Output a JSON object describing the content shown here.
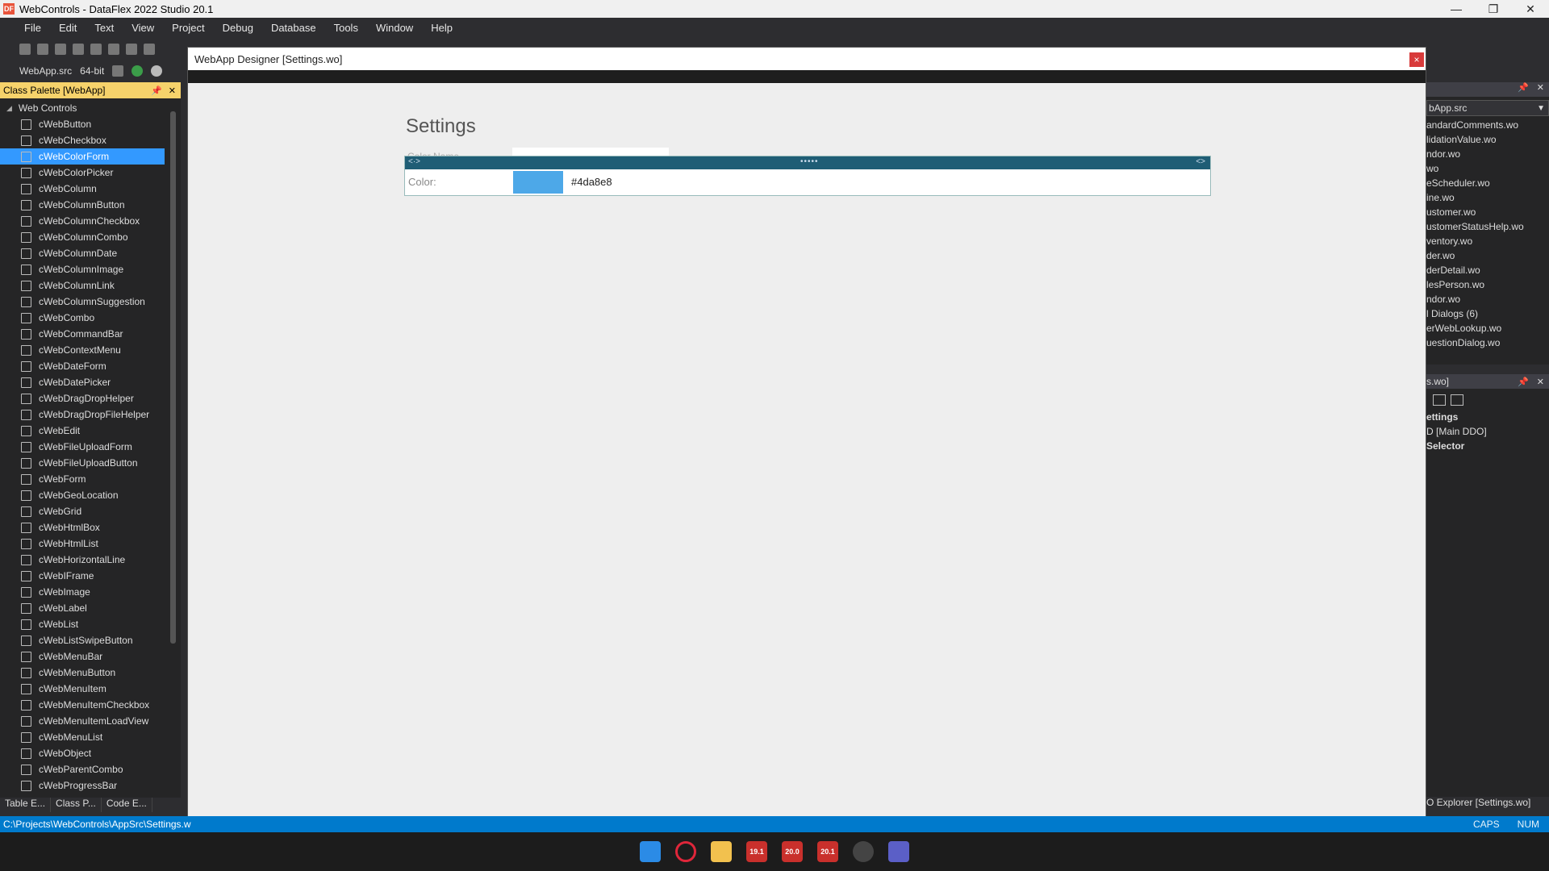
{
  "window": {
    "title": "WebControls - DataFlex 2022 Studio 20.1",
    "app_icon": "DF"
  },
  "menu": [
    "File",
    "Edit",
    "Text",
    "View",
    "Project",
    "Debug",
    "Database",
    "Tools",
    "Window",
    "Help"
  ],
  "toolbar2": {
    "workspace": "WebApp.src",
    "bitness": "64-bit"
  },
  "palette": {
    "title": "Class Palette [WebApp]",
    "root": "Web Controls",
    "items": [
      "cWebButton",
      "cWebCheckbox",
      "cWebColorForm",
      "cWebColorPicker",
      "cWebColumn",
      "cWebColumnButton",
      "cWebColumnCheckbox",
      "cWebColumnCombo",
      "cWebColumnDate",
      "cWebColumnImage",
      "cWebColumnLink",
      "cWebColumnSuggestion",
      "cWebCombo",
      "cWebCommandBar",
      "cWebContextMenu",
      "cWebDateForm",
      "cWebDatePicker",
      "cWebDragDropHelper",
      "cWebDragDropFileHelper",
      "cWebEdit",
      "cWebFileUploadForm",
      "cWebFileUploadButton",
      "cWebForm",
      "cWebGeoLocation",
      "cWebGrid",
      "cWebHtmlBox",
      "cWebHtmlList",
      "cWebHorizontalLine",
      "cWebIFrame",
      "cWebImage",
      "cWebLabel",
      "cWebList",
      "cWebListSwipeButton",
      "cWebMenuBar",
      "cWebMenuButton",
      "cWebMenuItem",
      "cWebMenuItemCheckbox",
      "cWebMenuItemLoadView",
      "cWebMenuList",
      "cWebObject",
      "cWebParentCombo",
      "cWebProgressBar"
    ],
    "selected": "cWebColorForm"
  },
  "bottom_tabs": [
    "Table E...",
    "Class P...",
    "Code E..."
  ],
  "status": {
    "path": "C:\\Projects\\WebControls\\AppSrc\\Settings.w",
    "caps": "CAPS",
    "num": "NUM"
  },
  "designer": {
    "title": "WebApp Designer [Settings.wo]",
    "close": "×",
    "page_title": "Settings",
    "ghost_label": "Color Name",
    "control": {
      "label": "Color:",
      "value": "#4da8e8",
      "swatch_color": "#4da8e8",
      "handle_dots": "•••••",
      "handle_left": "<·>",
      "handle_right": "<>"
    }
  },
  "workspace_panel": {
    "combo": "bApp.src",
    "files": [
      "andardComments.wo",
      "lidationValue.wo",
      "ndor.wo",
      "wo",
      "eScheduler.wo",
      "ine.wo",
      "ustomer.wo",
      "ustomerStatusHelp.wo",
      "ventory.wo",
      "der.wo",
      "derDetail.wo",
      "lesPerson.wo",
      "ndor.wo",
      "l Dialogs (6)",
      "erWebLookup.wo",
      "uestionDialog.wo"
    ]
  },
  "ddo_panel": {
    "title": "s.wo]",
    "items": [
      "ettings",
      "D [Main DDO]",
      "Selector"
    ],
    "footer": "O Explorer [Settings.wo]"
  },
  "taskbar": [
    "start-icon",
    "opera-icon",
    "explorer-icon",
    "19.1",
    "20.0",
    "20.1",
    "chrome-icon",
    "teams-icon"
  ]
}
